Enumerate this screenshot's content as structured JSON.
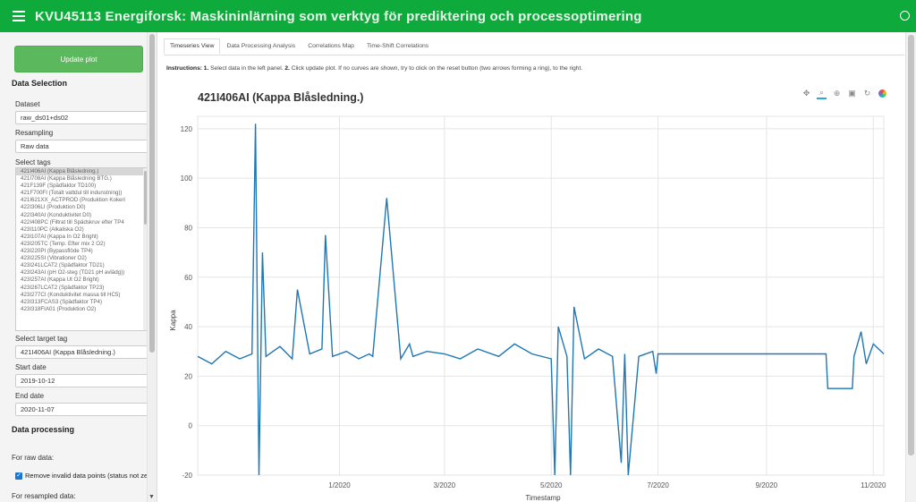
{
  "app": {
    "title": "KVU45113 Energiforsk: Maskininlärning som verktyg för prediktering och processoptimering"
  },
  "sidebar": {
    "update_button": "Update plot",
    "data_selection_title": "Data Selection",
    "dataset_label": "Dataset",
    "dataset_value": "raw_ds01+ds02",
    "resampling_label": "Resampling",
    "resampling_value": "Raw data",
    "select_tags_label": "Select tags",
    "tags": [
      "421I406AI (Kappa Blåsledning.)",
      "421I708AI (Kappa Blåsledning BTG.)",
      "421F139F (Spädfaktor TD100)",
      "421F700FI (Totalt vattdul till indunstning))",
      "421I621XX_ACTPROD (Produktion Kokeri",
      "422I306LI (Produktion D0)",
      "422I340AI (Konduktivitet D0)",
      "422I408PC (Filtrat till Spädskruv efter TP4",
      "423I110PC (Alkaliska O2)",
      "423I107AI (Kappa In O2 Bright)",
      "423I205TC (Temp. Efter mix 2 O2)",
      "423I220PI (Bypassflöde TP4)",
      "423I225SI (Vibrationer O2)",
      "423I241LCAT2 (Spädfaktor TD21)",
      "423I243AI (pH O2-steg (TD21 pH avlädg))",
      "423I257AI (Kappa Ut O2 Bright)",
      "423I267LCAT2 (Spädfaktor TP23)",
      "423I277CI (Konduktivitet massa till HC5)",
      "423I313FCAS3 (Spädfaktor TP4)",
      "423I318FIA01 (Produktion O2)"
    ],
    "target_label": "Select target tag",
    "target_value": "421I406AI (Kappa Blåsledning.)",
    "start_label": "Start date",
    "start_value": "2019-10-12",
    "end_label": "End date",
    "end_value": "2020-11-07",
    "processing_title": "Data processing",
    "raw_label": "For raw data:",
    "remove_invalid_label": "Remove invalid data points (status not ze",
    "resampled_label": "For resampled data:"
  },
  "tabs": [
    "Timeseries View",
    "Data Processing Analysis",
    "Correlations Map",
    "Time-Shift Correlations"
  ],
  "instructions": {
    "lead": "Instructions:",
    "s1n": "1.",
    "s1": "Select data in the left panel.",
    "s2n": "2.",
    "s2": "Click update plot. If no curves are shown, try to click on the reset button (two arrows forming a ring), to the right."
  },
  "toolbar_icons": [
    "pan-icon",
    "box-zoom-icon",
    "wheel-zoom-icon",
    "save-icon",
    "reset-icon",
    "bokeh-logo-icon"
  ],
  "chart_data": {
    "type": "line",
    "title": "421I406AI (Kappa Blåsledning.)",
    "xlabel": "Timestamp",
    "ylabel": "Kappa",
    "x_start": "2019-10-12",
    "x_end": "2020-11-07",
    "xticks": [
      "1/2020",
      "3/2020",
      "5/2020",
      "7/2020",
      "9/2020",
      "11/2020"
    ],
    "xtick_dates": [
      "2020-01-01",
      "2020-03-01",
      "2020-05-01",
      "2020-07-01",
      "2020-09-01",
      "2020-11-01"
    ],
    "yticks": [
      -20,
      0,
      20,
      40,
      60,
      80,
      100,
      120
    ],
    "ylim": [
      -20,
      125
    ],
    "grid": true,
    "color": "#1f77b4",
    "series": [
      {
        "x": [
          "2019-10-12",
          "2019-10-20",
          "2019-10-28",
          "2019-11-05",
          "2019-11-12",
          "2019-11-14",
          "2019-11-16",
          "2019-11-18",
          "2019-11-20",
          "2019-11-28",
          "2019-12-05",
          "2019-12-08",
          "2019-12-15",
          "2019-12-22",
          "2019-12-24",
          "2019-12-28",
          "2020-01-05",
          "2020-01-12",
          "2020-01-18",
          "2020-01-20",
          "2020-01-28",
          "2020-02-05",
          "2020-02-10",
          "2020-02-12",
          "2020-02-20",
          "2020-03-01",
          "2020-03-10",
          "2020-03-20",
          "2020-04-01",
          "2020-04-10",
          "2020-04-20",
          "2020-05-01",
          "2020-05-03",
          "2020-05-05",
          "2020-05-10",
          "2020-05-12",
          "2020-05-14",
          "2020-05-20",
          "2020-05-28",
          "2020-06-05",
          "2020-06-10",
          "2020-06-12",
          "2020-06-14",
          "2020-06-20",
          "2020-06-28",
          "2020-06-30",
          "2020-07-01",
          "2020-08-15",
          "2020-10-05",
          "2020-10-06",
          "2020-10-20",
          "2020-10-21",
          "2020-10-25",
          "2020-10-28",
          "2020-11-01",
          "2020-11-07"
        ],
        "y": [
          28,
          25,
          30,
          27,
          29,
          122,
          -20,
          70,
          28,
          32,
          27,
          55,
          29,
          31,
          77,
          28,
          30,
          27,
          29,
          28,
          92,
          27,
          33,
          28,
          30,
          29,
          27,
          31,
          28,
          33,
          29,
          27,
          -20,
          40,
          28,
          -20,
          48,
          27,
          31,
          28,
          -15,
          29,
          -20,
          28,
          30,
          21,
          29,
          29,
          29,
          15,
          15,
          28,
          38,
          25,
          33,
          29
        ]
      }
    ]
  }
}
